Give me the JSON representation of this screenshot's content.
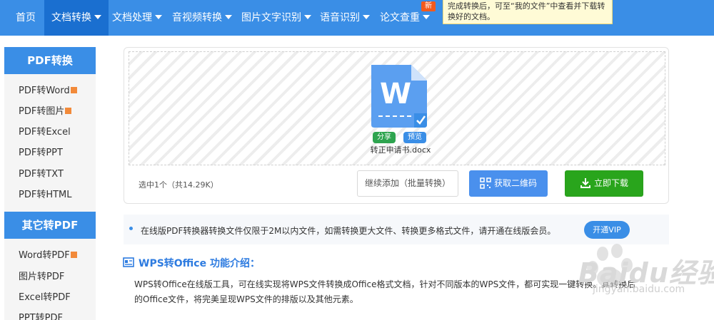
{
  "nav": {
    "items": [
      {
        "label": "首页",
        "caret": false
      },
      {
        "label": "文档转换",
        "caret": true,
        "active": true
      },
      {
        "label": "文档处理",
        "caret": true
      },
      {
        "label": "音视频转换",
        "caret": true
      },
      {
        "label": "图片文字识别",
        "caret": true
      },
      {
        "label": "语音识别",
        "caret": true
      },
      {
        "label": "论文查重",
        "caret": true
      }
    ],
    "new_badge": "新",
    "tooltip": "完成转换后，可至“我的文件”中查看并下载转换好的文档。"
  },
  "sidebar": {
    "section1": {
      "title": "PDF转换",
      "items": [
        "PDF转Word",
        "PDF转图片",
        "PDF转Excel",
        "PDF转PPT",
        "PDF转TXT",
        "PDF转HTML"
      ]
    },
    "section2": {
      "title": "其它转PDF",
      "items": [
        "Word转PDF",
        "图片转PDF",
        "Excel转PDF",
        "PPT转PDF"
      ]
    }
  },
  "upload": {
    "file_letter": "W",
    "share_label": "分享",
    "preview_label": "预览",
    "filename": "转正申请书.docx",
    "selection_info": "选中1个（共14.29K）",
    "add_button": "继续添加（批量转换）",
    "qr_button": "获取二维码",
    "download_button": "立即下载"
  },
  "notice": {
    "text": "在线版PDF转换器转换文件仅限于2M以内文件，如需转换更大文件、转换更多格式文件，请开通在线版会员。",
    "vip_button": "开通VIP"
  },
  "intro": {
    "title": "WPS转Office 功能介绍：",
    "line1": "WPS转Office在线版工具，可在线实现将WPS文件转换成Office格式文档，针对不同版本的WPS文件，都可实现一键转换。其转换后",
    "line2": "的Office文件，将完美呈现WPS文件的排版以及其他元素。"
  },
  "watermark": {
    "text": "Baidu经验",
    "sub": "jingyan.baidu.com"
  },
  "colors": {
    "primary": "#3a8ee6",
    "active_nav": "#1a6fd0",
    "download": "#29a51c",
    "badge": "#f25a1d"
  }
}
